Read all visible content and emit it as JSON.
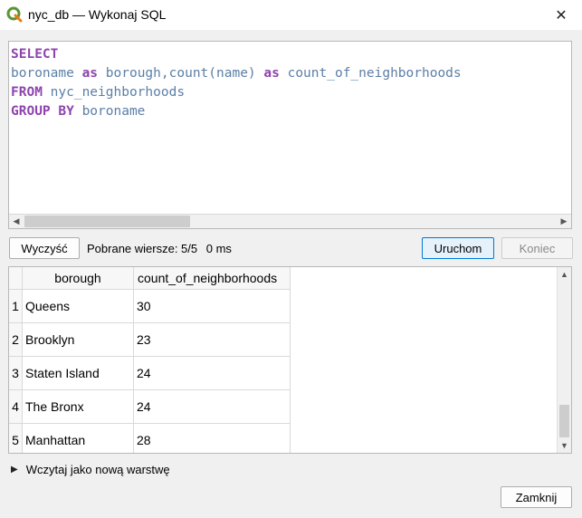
{
  "window": {
    "title": "nyc_db — Wykonaj SQL",
    "icons": {
      "app": "qgis-logo-icon",
      "close": "close-icon"
    }
  },
  "editor": {
    "lines": [
      [
        {
          "kind": "kw",
          "text": "SELECT"
        }
      ],
      [
        {
          "kind": "id",
          "text": "boroname "
        },
        {
          "kind": "kw",
          "text": "as"
        },
        {
          "kind": "id",
          "text": " borough,"
        },
        {
          "kind": "fn",
          "text": "count"
        },
        {
          "kind": "id",
          "text": "(name) "
        },
        {
          "kind": "kw",
          "text": "as"
        },
        {
          "kind": "id",
          "text": " count_of_neighborhoods"
        }
      ],
      [
        {
          "kind": "kw",
          "text": "FROM"
        },
        {
          "kind": "id",
          "text": " nyc_neighborhoods"
        }
      ],
      [
        {
          "kind": "kw",
          "text": "GROUP BY"
        },
        {
          "kind": "id",
          "text": " boroname"
        }
      ]
    ],
    "colors": {
      "keyword": "#8e44ad",
      "identifier": "#5b7fa7"
    }
  },
  "toolbar": {
    "clear_label": "Wyczyść",
    "rows_fetched": "Pobrane wiersze: 5/5",
    "elapsed": "0 ms",
    "run_label": "Uruchom",
    "stop_label": "Koniec"
  },
  "results": {
    "columns": [
      "borough",
      "count_of_neighborhoods"
    ],
    "rows": [
      {
        "n": "1",
        "borough": "Queens",
        "count": "30"
      },
      {
        "n": "2",
        "borough": "Brooklyn",
        "count": "23"
      },
      {
        "n": "3",
        "borough": "Staten Island",
        "count": "24"
      },
      {
        "n": "4",
        "borough": "The Bronx",
        "count": "24"
      },
      {
        "n": "5",
        "borough": "Manhattan",
        "count": "28"
      }
    ]
  },
  "load_layer": {
    "label": "Wczytaj jako nową warstwę",
    "icon": "expand-arrow-icon"
  },
  "footer": {
    "close_label": "Zamknij"
  },
  "accent_color": "#0078d7"
}
